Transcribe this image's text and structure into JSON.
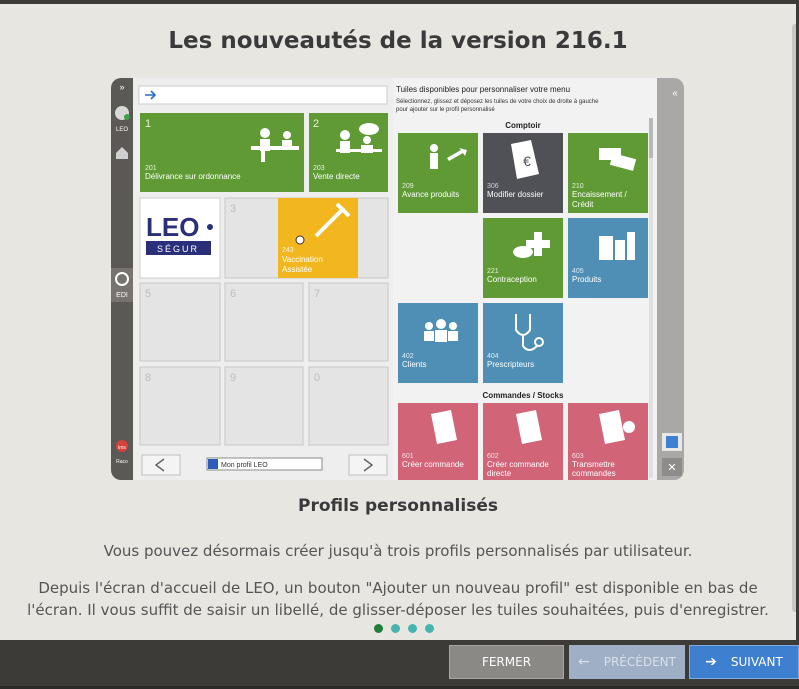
{
  "dialog": {
    "title": "Les nouveautés de la version 216.1",
    "subtitle": "Profils personnalisés",
    "paragraph1": "Vous pouvez désormais créer jusqu'à trois profils personnalisés par utilisateur.",
    "paragraph2": "Depuis l'écran d'accueil de LEO, un bouton \"Ajouter un nouveau profil\" est disponible en bas de",
    "paragraph3": "l'écran. Il vous suffit de saisir un libellé, de glisser-déposer les tuiles souhaitées, puis d'enregistrer.",
    "pagination": {
      "total": 4,
      "active": 1
    }
  },
  "buttons": {
    "close": "FERMER",
    "previous": "PRÉCÉDENT",
    "next": "SUIVANT"
  },
  "screenshot": {
    "sidebar": {
      "leo_label": "LEO",
      "edi_label": "EDI",
      "ims_label": "ims",
      "raco_label": "Raco"
    },
    "logo_top": "LEO",
    "logo_bottom": "SÉGUR",
    "profile_name": "Mon profil LEO",
    "grid_tiles": [
      {
        "slot": "1",
        "code": "201",
        "label": "Délivrance sur ordonnance"
      },
      {
        "slot": "2",
        "code": "203",
        "label": "Vente directe"
      },
      {
        "slot": "3",
        "code": "243",
        "label": "Vaccination",
        "label2": "Assistée"
      }
    ],
    "empty_slots": [
      "5",
      "6",
      "7",
      "8",
      "9",
      "0"
    ],
    "panel": {
      "title": "Tuiles disponibles pour personnaliser votre menu",
      "hint1": "Sélectionnez, glissez et déposez les tuiles de votre choix de droite à gauche",
      "hint2": "pour ajouter sur le profil personnalisé",
      "section1": "Comptoir",
      "section2": "Commandes / Stocks",
      "tiles": [
        {
          "code": "209",
          "label": "Avance produits",
          "label2": ""
        },
        {
          "code": "306",
          "label": "Modifier dossier",
          "label2": ""
        },
        {
          "code": "210",
          "label": "Encaissement /",
          "label2": "Crédit"
        },
        {
          "code": "221",
          "label": "Contraception",
          "label2": ""
        },
        {
          "code": "405",
          "label": "Produits",
          "label2": ""
        },
        {
          "code": "402",
          "label": "Clients",
          "label2": ""
        },
        {
          "code": "404",
          "label": "Prescripteurs",
          "label2": ""
        },
        {
          "code": "601",
          "label": "Créer commande",
          "label2": ""
        },
        {
          "code": "602",
          "label": "Créer commande",
          "label2": "directe"
        },
        {
          "code": "603",
          "label": "Transmettre",
          "label2": "commandes"
        }
      ]
    }
  },
  "colors": {
    "green_tile": "#5f9a34",
    "dark_tile": "#4f5157",
    "blue_tile": "#4f8fb5",
    "pink_tile": "#d16577",
    "yellow_tile": "#f2b71f",
    "next_button": "#3f7fd0"
  }
}
